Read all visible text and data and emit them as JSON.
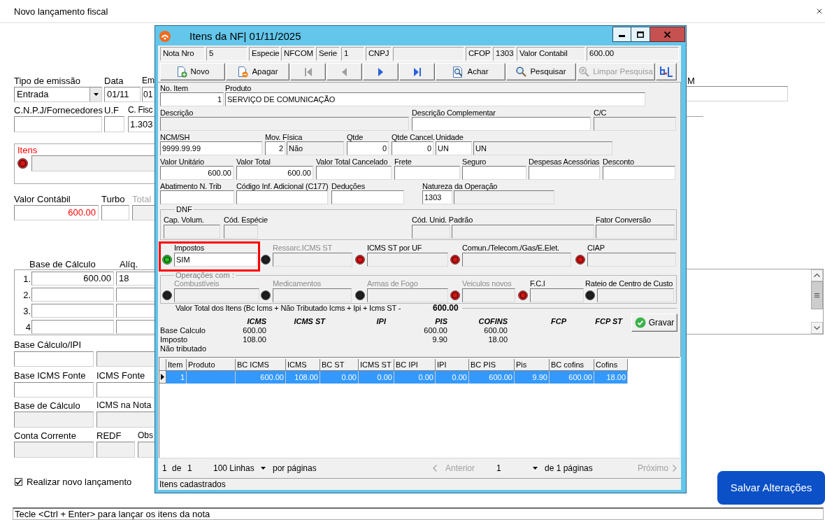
{
  "window": {
    "title": "Novo lançamento fiscal"
  },
  "form": {
    "top_rows": [
      [
        {
          "label": "Tipo de emissão",
          "value": "Entrada",
          "kind": "dropdown",
          "readonly": false
        },
        {
          "label": "Data",
          "value": "01/11",
          "kind": "text",
          "readonly": false
        },
        {
          "label": "Em",
          "value": "01",
          "kind": "text",
          "readonly": false
        }
      ],
      [
        {
          "label": "C.N.P.J/Fornecedores",
          "readonly": false
        },
        {
          "label": "U.F",
          "readonly": false
        },
        {
          "label": "C. Fisc",
          "value": "1.303",
          "kind": "text",
          "readonly": false
        }
      ]
    ],
    "items_group": {
      "label": "Itens",
      "alert": true,
      "color": "#e01010",
      "readonly": true
    },
    "value_row": [
      {
        "label": "Valor Contábil",
        "value": "600.00",
        "kind": "number",
        "alert": true,
        "readonly": false,
        "disabled": false
      },
      {
        "label": "Turbo",
        "readonly": false,
        "disabled": false
      },
      {
        "label": "Total",
        "readonly": true,
        "disabled": true
      }
    ],
    "base_calculo": {
      "columns": [
        "Base de Cálculo",
        "Alíq."
      ],
      "rows": [
        {
          "index": "1.",
          "base": "600.00",
          "rate": "18"
        },
        {
          "index": "2."
        },
        {
          "index": "3."
        },
        {
          "index": "4"
        }
      ]
    },
    "bottom_rows": [
      [
        {
          "label": "Base Cálculo/IPI",
          "readonly": false
        },
        {
          "readonly": true
        }
      ],
      [
        {
          "label": "Base ICMS Fonte",
          "readonly": false
        },
        {
          "label": "ICMS Fonte",
          "readonly": false
        }
      ],
      [
        {
          "label": "Base de Cálculo",
          "readonly": true
        },
        {
          "label": "ICMS na Nota",
          "readonly": true
        }
      ],
      [
        {
          "label": "Conta Corrente",
          "readonly": true
        },
        {
          "label": "REDF",
          "readonly": true
        },
        {
          "label": "Obs",
          "readonly": true
        }
      ]
    ],
    "new_entry": {
      "label": "Realizar novo lançamento",
      "checked": true
    },
    "side_field": {
      "label": "M"
    },
    "save_button": {
      "label": "Salvar Alterações"
    },
    "hint": "Tecle <Ctrl + Enter> para lançar os itens da nota"
  },
  "dialog": {
    "title": "Itens da NF| 01/11/2025",
    "header": [
      {
        "label": "Nota Nro",
        "value": "5"
      },
      {
        "label": "Especie",
        "value": "NFCOM"
      },
      {
        "label": "Serie",
        "value": "1"
      },
      {
        "label": "CNPJ"
      },
      {
        "label": "CFOP",
        "value": "1303"
      },
      {
        "label": "Valor Contabil",
        "value": "600.00"
      }
    ],
    "toolbar": [
      {
        "kind": "new",
        "label": "Novo",
        "disabled": false
      },
      {
        "kind": "delete",
        "label": "Apagar",
        "disabled": false
      },
      {
        "kind": "first",
        "disabled": true
      },
      {
        "kind": "previous",
        "disabled": true
      },
      {
        "kind": "next",
        "disabled": false
      },
      {
        "kind": "last",
        "disabled": false
      },
      {
        "kind": "find",
        "label": "Achar",
        "disabled": false
      },
      {
        "kind": "search",
        "label": "Pesquisar",
        "disabled": false
      },
      {
        "kind": "clear",
        "label": "Limpar Pesquisa",
        "disabled": true
      },
      {
        "kind": "layout",
        "disabled": false
      }
    ],
    "form_lines": [
      {
        "groups": [
          {
            "label": "No. Item",
            "fields": [
              {
                "value": "1",
                "kind": "number",
                "readonly": false
              }
            ]
          },
          {
            "label": "Produto",
            "fields": [
              {
                "value": "SERVIÇO DE COMUNICAÇÃO",
                "kind": "text",
                "readonly": false
              }
            ]
          }
        ]
      },
      {
        "groups": [
          {
            "label": "Descrição",
            "fields": [
              {
                "readonly": true
              }
            ]
          },
          {
            "label": "Descrição Complementar",
            "fields": [
              {
                "readonly": false
              }
            ]
          },
          {
            "label": "C/C",
            "fields": [
              {
                "readonly": true
              }
            ]
          }
        ]
      },
      {
        "groups": [
          {
            "label": "NCM/SH",
            "fields": [
              {
                "value": "9999.99.99",
                "kind": "text",
                "readonly": false
              }
            ]
          },
          {
            "label": "Mov. Física",
            "fields": [
              {
                "value": "2",
                "kind": "number",
                "readonly": false
              },
              {
                "value": "Não",
                "kind": "text",
                "readonly": true
              }
            ]
          },
          {
            "label": "Qtde",
            "fields": [
              {
                "value": "0",
                "kind": "number",
                "readonly": false
              }
            ]
          },
          {
            "label": "Qtde Cancel.",
            "fields": [
              {
                "value": "0",
                "kind": "number",
                "readonly": false
              }
            ]
          },
          {
            "label": "Unidade",
            "fields": [
              {
                "value": "UN",
                "kind": "text",
                "readonly": false
              },
              {
                "value": "UN",
                "kind": "text",
                "readonly": true
              }
            ]
          }
        ]
      },
      {
        "groups": [
          {
            "label": "Valor Unitário",
            "fields": [
              {
                "value": "600.00",
                "kind": "number",
                "readonly": false
              }
            ]
          },
          {
            "label": "Valor Total",
            "fields": [
              {
                "value": "600.00",
                "kind": "number",
                "readonly": false
              }
            ]
          },
          {
            "label": "Valor Total Cancelado",
            "fields": [
              {
                "readonly": false
              }
            ]
          },
          {
            "label": "Frete",
            "fields": [
              {
                "readonly": false
              }
            ]
          },
          {
            "label": "Seguro",
            "fields": [
              {
                "readonly": false
              }
            ]
          },
          {
            "label": "Despesas Acessórias",
            "fields": [
              {
                "readonly": false
              }
            ]
          },
          {
            "label": "Desconto",
            "fields": [
              {
                "readonly": false
              }
            ]
          }
        ]
      },
      {
        "groups": [
          {
            "label": "Abatimento N. Trib",
            "fields": [
              {
                "readonly": false
              }
            ]
          },
          {
            "label": "Código Inf. Adicional (C177)",
            "fields": [
              {
                "readonly": false
              }
            ]
          },
          {
            "label": "Deduções",
            "fields": [
              {
                "readonly": false
              }
            ]
          },
          {
            "label": "Natureza da Operação",
            "fields": [
              {
                "value": "1303",
                "kind": "text",
                "readonly": false
              },
              {
                "readonly": true
              }
            ]
          }
        ]
      }
    ],
    "dnf": {
      "legend": "DNF",
      "groups": [
        {
          "label": "Cap. Volum.",
          "fields": [
            {
              "readonly": true
            }
          ]
        },
        {
          "label": "Cód. Espécie",
          "fields": [
            {
              "readonly": true
            }
          ]
        },
        {
          "label": "Cód. Unid. Padrão",
          "fields": [
            {
              "readonly": true
            },
            {
              "readonly": true
            }
          ]
        },
        {
          "label": "Fator Conversão",
          "fields": [
            {
              "readonly": true
            }
          ]
        }
      ]
    },
    "indicators": [
      {
        "label": "Impostos",
        "color": "#20c020",
        "value": "SIM",
        "readonly": false,
        "disabled": false,
        "highlighted": true
      },
      {
        "label": "Ressarc.ICMS ST",
        "color": "#202020",
        "readonly": true,
        "disabled": true,
        "highlighted": false
      },
      {
        "label": "ICMS ST por UF",
        "color": "#e01010",
        "readonly": true,
        "disabled": false,
        "highlighted": false
      },
      {
        "label": "Comun./Telecom./Gas/E.Elet.",
        "color": "#e01010",
        "readonly": true,
        "disabled": false,
        "highlighted": false
      },
      {
        "label": "CIAP",
        "color": "#e01010",
        "readonly": true,
        "disabled": false,
        "highlighted": false
      }
    ],
    "operations": {
      "legend": "Operações com :",
      "disabled": true,
      "items": [
        {
          "label": "Combustíveis",
          "color": "#202020",
          "readonly": true,
          "disabled": true
        },
        {
          "label": "Medicamentos",
          "color": "#202020",
          "readonly": true,
          "disabled": true
        },
        {
          "label": "Armas de Fogo",
          "color": "#202020",
          "readonly": true,
          "disabled": true
        },
        {
          "label": "Veiculos novos",
          "color": "#e01010",
          "readonly": true,
          "disabled": true
        },
        {
          "label": "F.C.I",
          "color": "#e01010",
          "readonly": true,
          "disabled": false
        },
        {
          "label": "Rateio de Centro de Custo",
          "color": "#202020",
          "readonly": true,
          "disabled": false
        }
      ]
    },
    "total": {
      "label": "Valor Total dos Itens (Bc Icms + Não Tributado Icms + Ipi + Icms ST -",
      "value": "600.00"
    },
    "summary": {
      "row_labels": [
        "Base Calculo",
        "Imposto",
        "Não tributado"
      ],
      "columns": [
        {
          "name": "ICMS",
          "values": [
            "600.00",
            "108.00"
          ]
        },
        {
          "name": "ICMS ST"
        },
        {
          "name": "IPI"
        },
        {
          "name": "PIS",
          "values": [
            "600.00",
            "9.90"
          ]
        },
        {
          "name": "COFINS",
          "values": [
            "600.00",
            "18.00"
          ]
        },
        {
          "name": "FCP"
        },
        {
          "name": "FCP ST"
        }
      ]
    },
    "save": {
      "label": "Gravar"
    },
    "grid": {
      "columns": [
        "Item",
        "Produto",
        "BC ICMS",
        "ICMS",
        "BC ST",
        "ICMS ST",
        "BC IPI",
        "IPI",
        "BC PIS",
        "Pis",
        "BC cofins",
        "Cofins"
      ],
      "rows": [
        {
          "selected": true,
          "cells": [
            "1",
            null,
            "600.00",
            "108.00",
            "0.00",
            "0.00",
            "0.00",
            "0.00",
            "600.00",
            "9.90",
            "600.00",
            "18.00"
          ]
        }
      ]
    },
    "pagination": {
      "first": "1",
      "of": "de",
      "last": "1",
      "page_size": "100 Linhas",
      "page_size_label": "por páginas",
      "previous": {
        "label": "Anterior",
        "disabled": true
      },
      "page": "1",
      "pages": "de 1 páginas",
      "next": {
        "label": "Próximo",
        "disabled": true
      }
    },
    "status": "Itens cadastrados"
  }
}
